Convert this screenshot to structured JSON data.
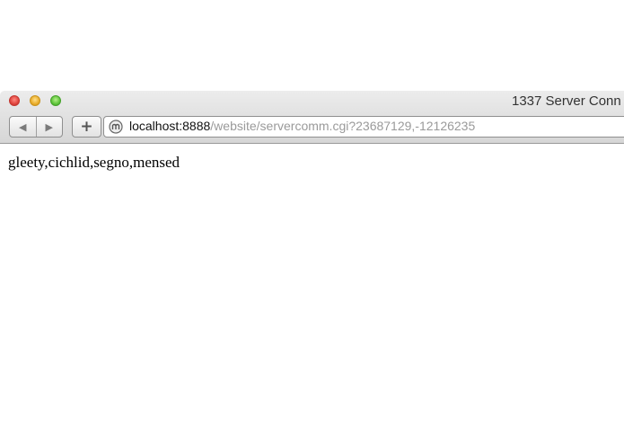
{
  "window": {
    "title": "1337 Server Conn"
  },
  "toolbar": {
    "back_icon": "back-arrow-icon",
    "forward_icon": "forward-arrow-icon",
    "add_label": "+"
  },
  "address_bar": {
    "host": "localhost:8888",
    "path": "/website/servercomm.cgi?23687129,-12126235",
    "site_icon": "globe-icon"
  },
  "page": {
    "body_text": "gleety,cichlid,segno,mensed"
  }
}
